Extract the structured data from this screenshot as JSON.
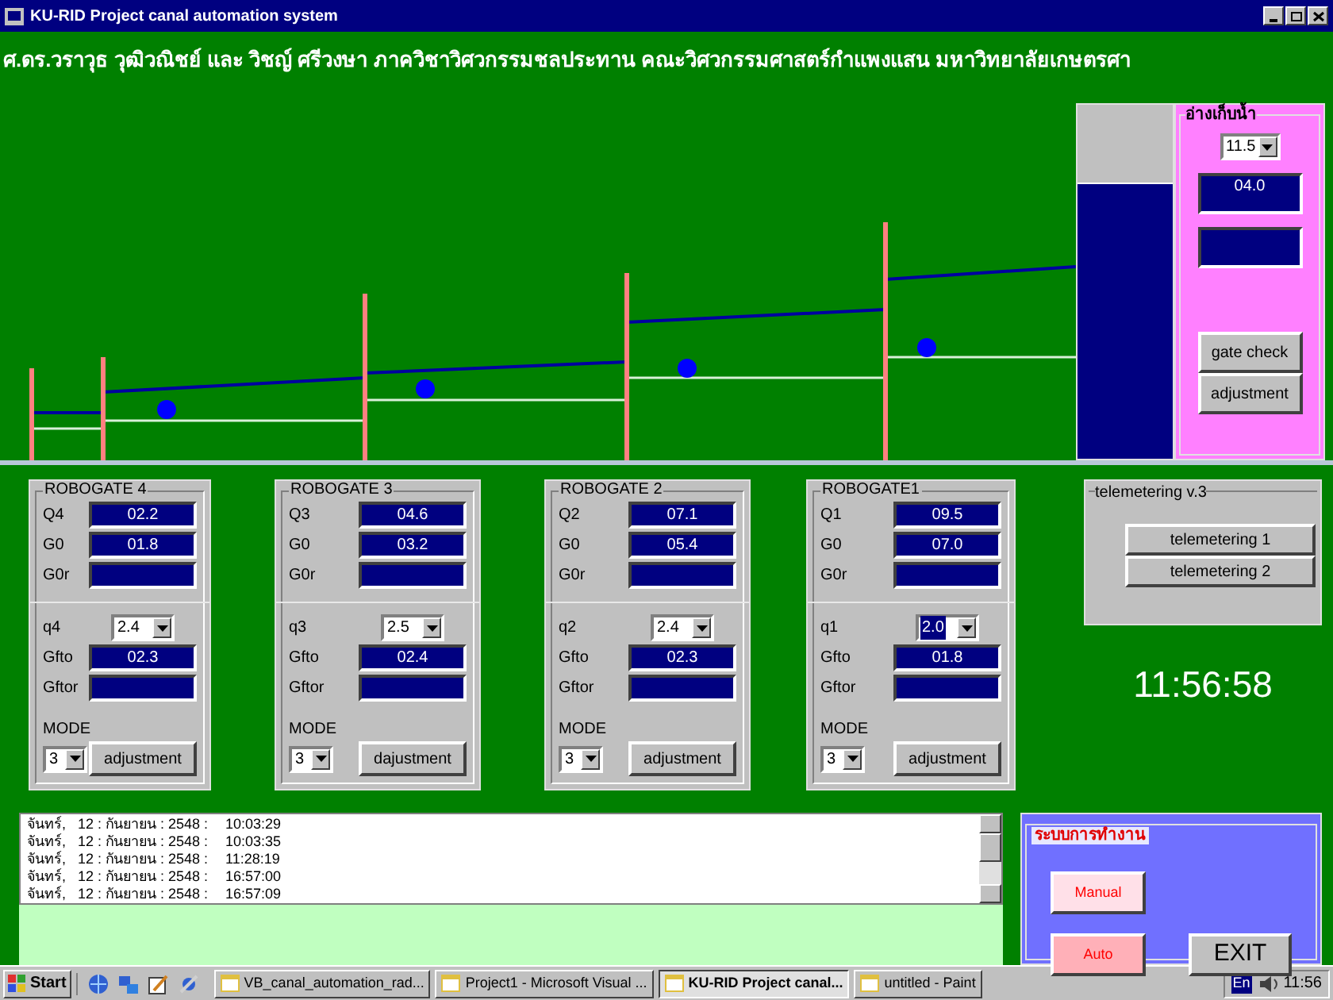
{
  "window": {
    "title": "KU-RID Project canal automation system"
  },
  "header": "ศ.ดร.วราวุธ วุฒิวณิชย์ และ วิชญ์ ศรีวงษา ภาควิชาวิศวกรรมชลประทาน คณะวิศวกรรมศาสตร์กำแพงแสน มหาวิทยาลัยเกษตรศา",
  "reservoir": {
    "level": 0.78,
    "title": "อ่างเก็บน้ำ",
    "dropdown": "11.5",
    "field_1": "04.0",
    "buttons": [
      "gate check",
      "adjustment"
    ]
  },
  "gates": [
    {
      "title": "ROBOGATE 4",
      "rows": [
        {
          "label": "Q4",
          "value": "02.2"
        },
        {
          "label": "G0",
          "value": "01.8"
        },
        {
          "label": "G0r"
        }
      ],
      "q_label": "q4",
      "q_value": "2.4",
      "q_focused": false,
      "rows2": [
        {
          "label": "Gfto",
          "value": "02.3"
        },
        {
          "label": "Gftor"
        }
      ],
      "mode_label": "MODE",
      "mode_value": "3",
      "button": "adjustment"
    },
    {
      "title": "ROBOGATE 3",
      "rows": [
        {
          "label": "Q3",
          "value": "04.6"
        },
        {
          "label": "G0",
          "value": "03.2"
        },
        {
          "label": "G0r"
        }
      ],
      "q_label": "q3",
      "q_value": "2.5",
      "q_focused": false,
      "rows2": [
        {
          "label": "Gfto",
          "value": "02.4"
        },
        {
          "label": "Gftor"
        }
      ],
      "mode_label": "MODE",
      "mode_value": "3",
      "button": "dajustment"
    },
    {
      "title": "ROBOGATE 2",
      "rows": [
        {
          "label": "Q2",
          "value": "07.1"
        },
        {
          "label": "G0",
          "value": "05.4"
        },
        {
          "label": "G0r"
        }
      ],
      "q_label": "q2",
      "q_value": "2.4",
      "q_focused": false,
      "rows2": [
        {
          "label": "Gfto",
          "value": "02.3"
        },
        {
          "label": "Gftor"
        }
      ],
      "mode_label": "MODE",
      "mode_value": "3",
      "button": "adjustment"
    },
    {
      "title": "ROBOGATE1",
      "rows": [
        {
          "label": "Q1",
          "value": "09.5"
        },
        {
          "label": "G0",
          "value": "07.0"
        },
        {
          "label": "G0r"
        }
      ],
      "q_label": "q1",
      "q_value": "2.0",
      "q_focused": true,
      "rows2": [
        {
          "label": "Gfto",
          "value": "01.8"
        },
        {
          "label": "Gftor"
        }
      ],
      "mode_label": "MODE",
      "mode_value": "3",
      "button": "adjustment"
    }
  ],
  "telemetering": {
    "title": "telemetering v.3",
    "buttons": [
      "telemetering 1",
      "telemetering 2"
    ]
  },
  "clock": "11:56:58",
  "log": [
    {
      "date": "จันทร์,   12 : กันยายน : 2548 :",
      "time": "10:03:29"
    },
    {
      "date": "จันทร์,   12 : กันยายน : 2548 :",
      "time": "10:03:35"
    },
    {
      "date": "จันทร์,   12 : กันยายน : 2548 :",
      "time": "11:28:19"
    },
    {
      "date": "จันทร์,   12 : กันยายน : 2548 :",
      "time": "16:57:00"
    },
    {
      "date": "จันทร์,   12 : กันยายน : 2548 :",
      "time": "16:57:09"
    }
  ],
  "mode_panel": {
    "title": "ระบบการทำงาน",
    "manual": "Manual",
    "auto": "Auto",
    "exit": "EXIT"
  },
  "taskbar": {
    "start": "Start",
    "tasks": [
      {
        "label": "VB_canal_automation_rad...",
        "selected": false
      },
      {
        "label": "Project1 - Microsoft Visual ...",
        "selected": false
      },
      {
        "label": "KU-RID Project canal...",
        "selected": true
      },
      {
        "label": "untitled - Paint",
        "selected": false
      }
    ],
    "language": "En",
    "time": "11:56"
  }
}
